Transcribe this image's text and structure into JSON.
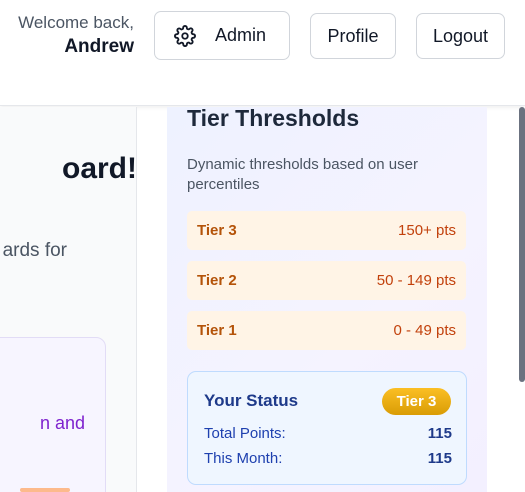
{
  "header": {
    "welcome_line": "Welcome back,",
    "user_name": "Andrew",
    "admin_label": "Admin",
    "profile_label": "Profile",
    "logout_label": "Logout"
  },
  "left": {
    "title_fragment": "oard!",
    "subtitle_fragment": "ards for",
    "card_text_fragment": "n and"
  },
  "tiers": {
    "title": "Tier Thresholds",
    "description": "Dynamic thresholds based on user percentiles",
    "items": [
      {
        "name": "Tier 3",
        "range": "150+ pts"
      },
      {
        "name": "Tier 2",
        "range": "50 - 149 pts"
      },
      {
        "name": "Tier 1",
        "range": "0 - 49 pts"
      }
    ]
  },
  "status": {
    "title": "Your Status",
    "badge": "Tier 3",
    "total_label": "Total Points:",
    "total_value": "115",
    "month_label": "This Month:",
    "month_value": "115"
  },
  "colors": {
    "tier_bg": "#fff4e6",
    "tier_text": "#b45309",
    "badge_gold": "#f59e0b",
    "status_blue": "#1e3a8a"
  },
  "icons": {
    "admin": "gear-icon"
  }
}
